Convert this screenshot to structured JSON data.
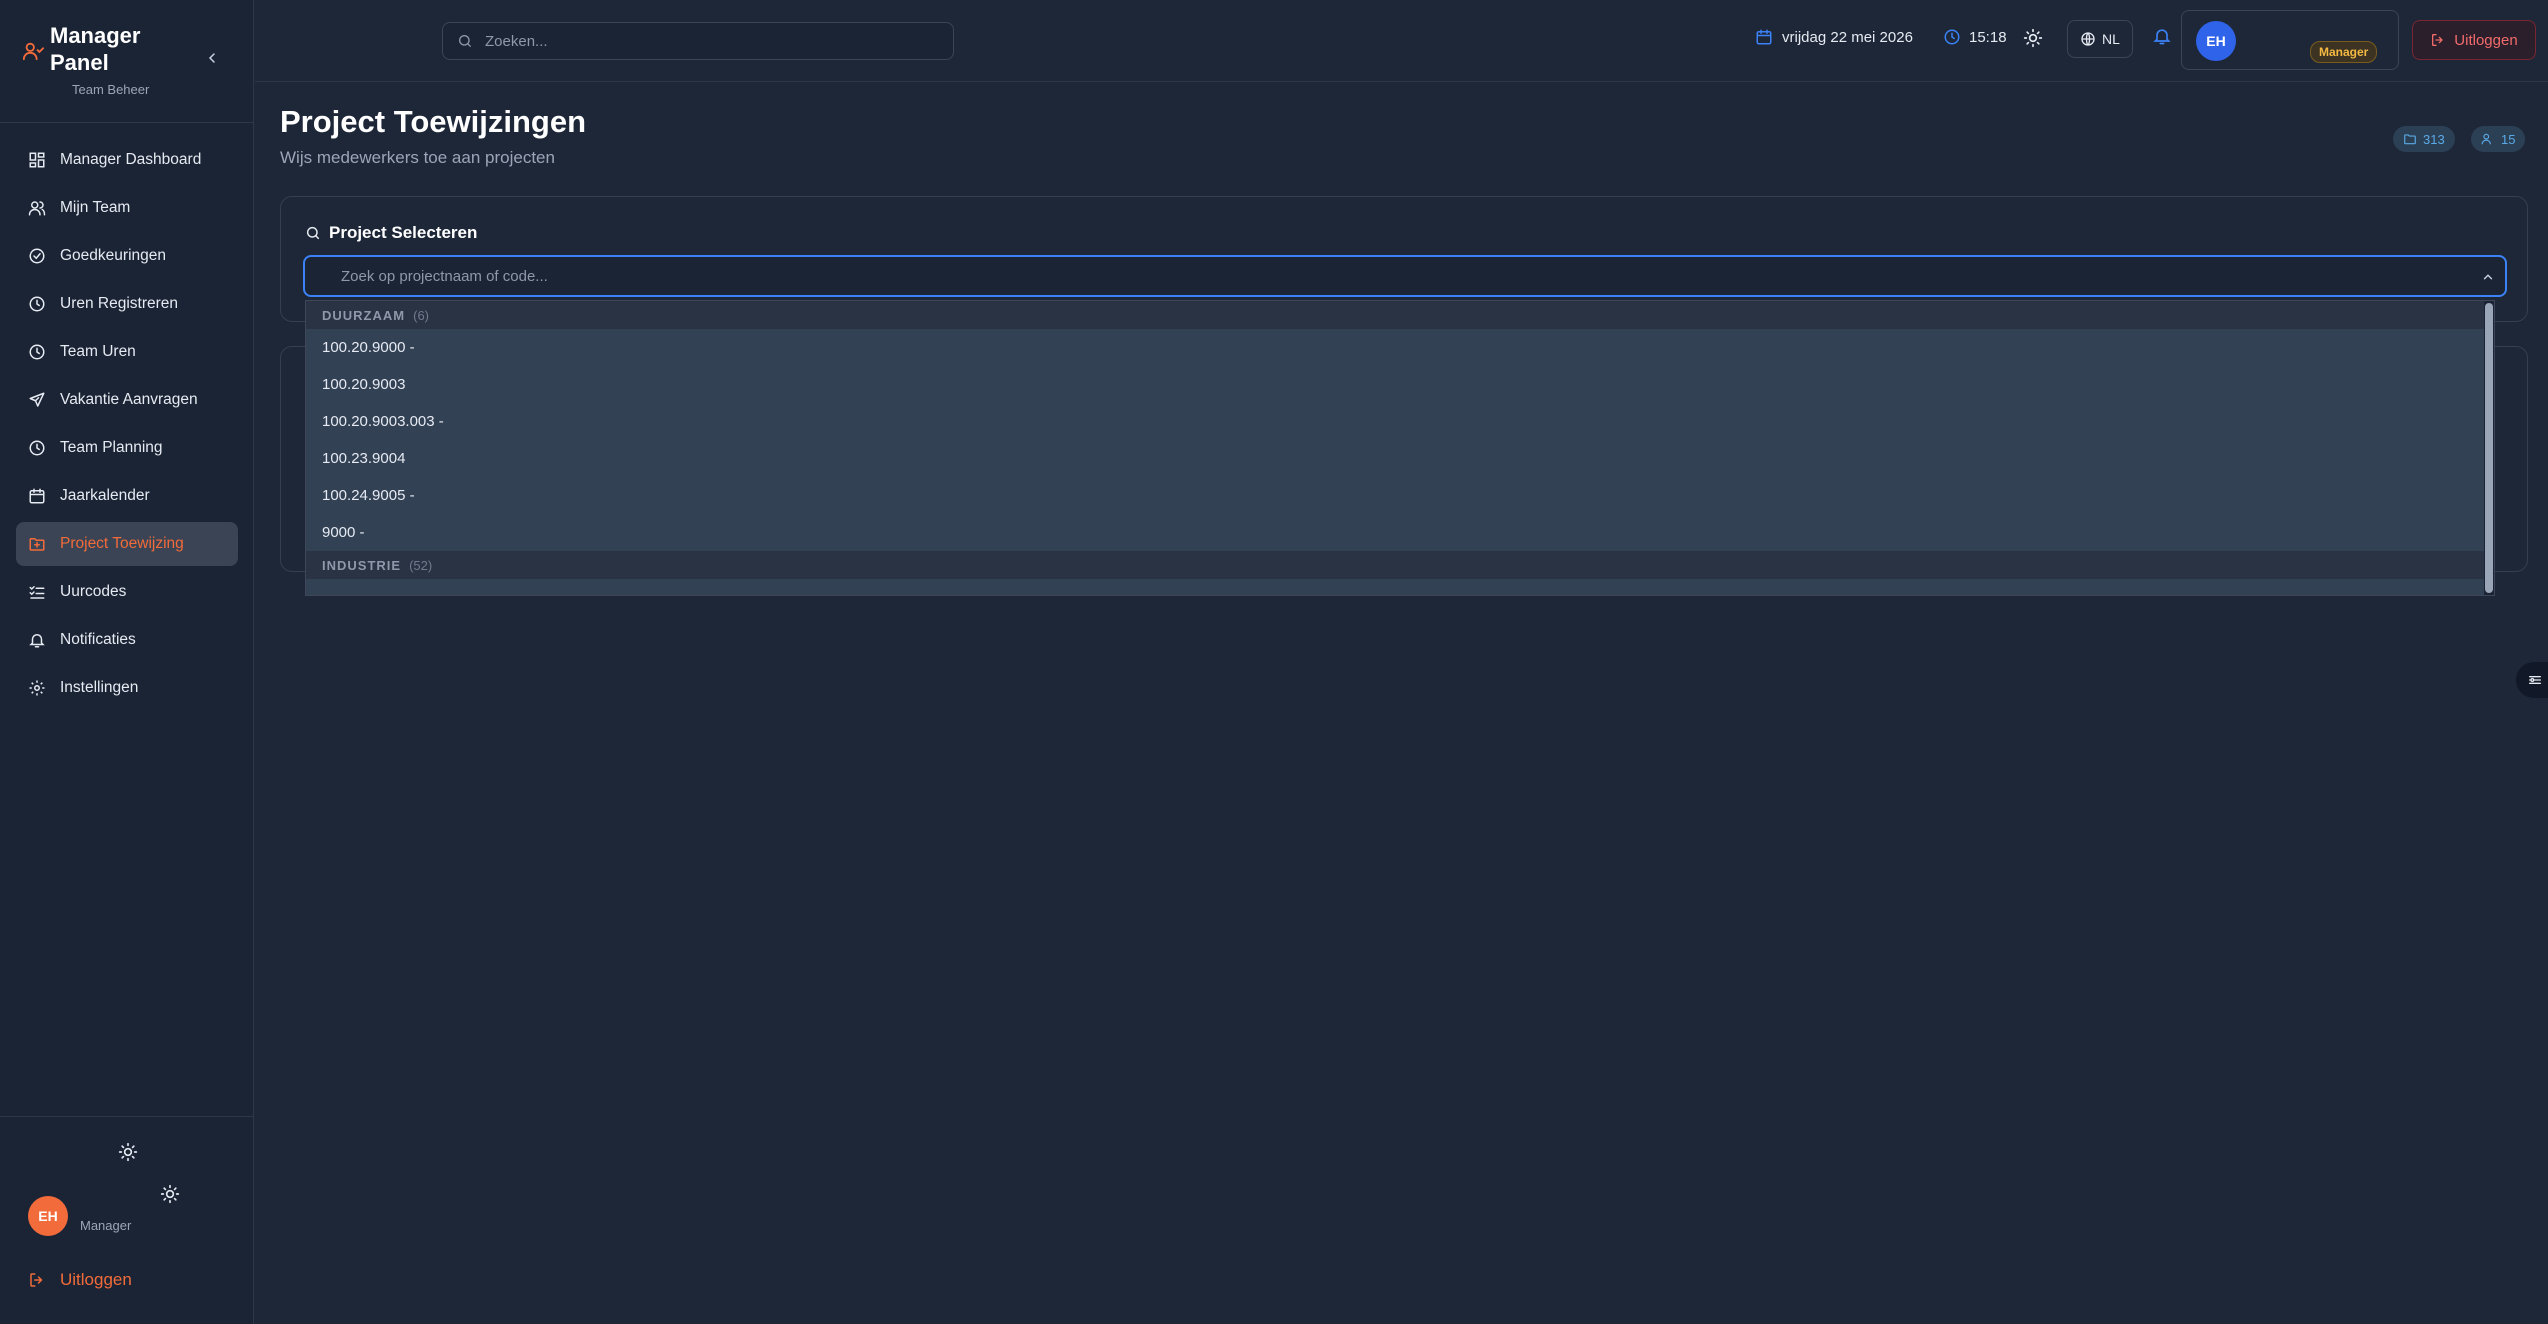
{
  "sidebar": {
    "title": "Manager Panel",
    "subtitle": "Team Beheer",
    "items": [
      {
        "label": "Manager Dashboard",
        "icon": "dashboard-icon"
      },
      {
        "label": "Mijn Team",
        "icon": "users-icon"
      },
      {
        "label": "Goedkeuringen",
        "icon": "check-circle-icon"
      },
      {
        "label": "Uren Registreren",
        "icon": "clock-icon"
      },
      {
        "label": "Team Uren",
        "icon": "clock-icon"
      },
      {
        "label": "Vakantie Aanvragen",
        "icon": "plane-icon"
      },
      {
        "label": "Team Planning",
        "icon": "clock-icon"
      },
      {
        "label": "Jaarkalender",
        "icon": "calendar-icon"
      },
      {
        "label": "Project Toewijzing",
        "icon": "folder-icon"
      },
      {
        "label": "Uurcodes",
        "icon": "list-check-icon"
      },
      {
        "label": "Notificaties",
        "icon": "bell-icon"
      },
      {
        "label": "Instellingen",
        "icon": "gear-icon"
      }
    ],
    "active_index": 8,
    "user": {
      "initials": "EH",
      "role": "Manager"
    },
    "logout_label": "Uitloggen"
  },
  "topbar": {
    "search_placeholder": "Zoeken...",
    "date": "vrijdag 22 mei 2026",
    "time": "15:18",
    "language": "NL",
    "user": {
      "initials": "EH",
      "role": "Manager"
    },
    "logout_label": "Uitloggen"
  },
  "page": {
    "title": "Project Toewijzingen",
    "subtitle": "Wijs medewerkers toe aan projecten",
    "stats": {
      "projects": "313",
      "members": "15"
    }
  },
  "project_select": {
    "title": "Project Selecteren",
    "placeholder": "Zoek op projectnaam of code..."
  },
  "dropdown": {
    "groups": [
      {
        "name": "DUURZAAM",
        "count": "(6)",
        "items": [
          "100.20.9000 -",
          "100.20.9003",
          "100.20.9003.003 -",
          "100.23.9004",
          "100.24.9005 -",
          "9000 -"
        ]
      },
      {
        "name": "INDUSTRIE",
        "count": "(52)",
        "items": []
      }
    ]
  },
  "colors": {
    "accent": "#f26b3a",
    "focus": "#3b82f6",
    "background": "#1e2738",
    "sidebar": "#1b2434"
  }
}
